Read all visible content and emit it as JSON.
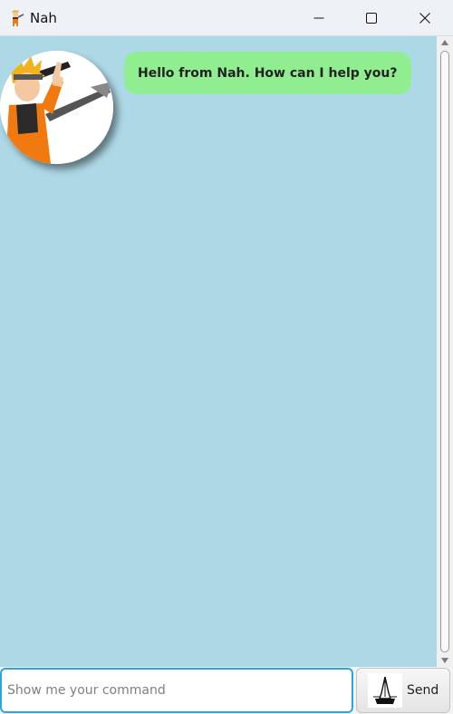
{
  "window": {
    "title": "Nah",
    "app_icon": "ninja-character-icon",
    "controls": {
      "minimize": "minimize-icon",
      "maximize": "maximize-icon",
      "close": "close-icon"
    }
  },
  "chat": {
    "background": "#add8e6",
    "messages": [
      {
        "sender_avatar": "ninja-character-avatar",
        "text": "Hello from Nah. How can I help you?",
        "bubble_color": "#90ee90"
      }
    ]
  },
  "input": {
    "placeholder": "Show me your command",
    "value": "",
    "focus_color": "#29a8e0"
  },
  "send_button": {
    "label": "Send",
    "icon": "praying-hands-icon"
  }
}
